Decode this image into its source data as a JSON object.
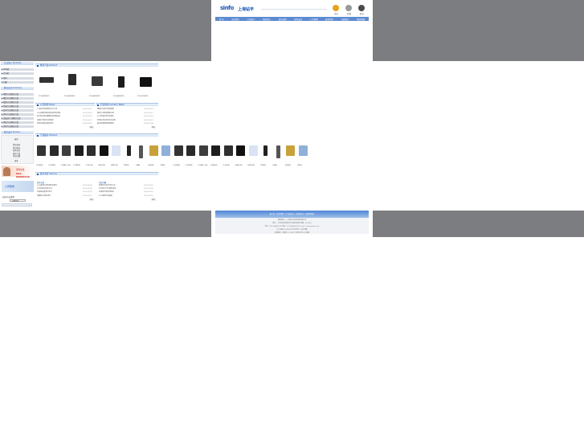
{
  "header": {
    "logo_text": "sinfo",
    "brand_name": "上海钻丰",
    "icons": [
      {
        "name": "home-icon",
        "label": "首页",
        "color": "#e6a21e"
      },
      {
        "name": "favorite-icon",
        "label": "收藏",
        "color": "#9a9a9a"
      },
      {
        "name": "contact-icon",
        "label": "联系",
        "color": "#4a4a4a"
      }
    ]
  },
  "nav": {
    "items": [
      "首 页",
      "关于我们",
      "产品中心",
      "新闻中心",
      "成功案例",
      "技术支持",
      "人才招聘",
      "联系我们",
      "在线留言",
      "网站地图"
    ]
  },
  "sidebar": {
    "products_title": "产品中心 Products",
    "product_categories": [
      "POS机",
      "打印机"
    ],
    "product_items": [
      "条码",
      "扫描",
      "其他"
    ],
    "industry_title": "解决方案 Solutions",
    "industries": [
      "零售行业解决方案",
      "餐饮行业解决方案",
      "服装行业解决方案",
      "物流行业解决方案",
      "医药行业解决方案",
      "超市行业解决方案",
      "连锁店行业解决方案",
      "酒店行业解决方案",
      "其他行业解决方案"
    ],
    "service_title": "服务支持 Service",
    "service_heading": "服务",
    "service_items": [
      "售前咨询",
      "售后服务",
      "技术支持",
      "驱动下载",
      "常见问题"
    ],
    "service_more": "更多",
    "sales_hotline": "021-68580128",
    "sales_label": "销售热线",
    "honor_label": "公司荣誉",
    "search_label": "站内产品搜索",
    "search_select_value": "全部分类"
  },
  "featured": {
    "title": "推荐产品 Product",
    "items": [
      "POS收银机系列",
      "POS收银机系列",
      "POS收银机系列",
      "POS收银机系列",
      "POS打印机系列"
    ]
  },
  "news": {
    "left_title": "公司新闻 News",
    "right_title": "行业新闻 Industry News",
    "left_items": [
      {
        "title": "上海钻丰收银系统正式上线",
        "date": "2011-03-21"
      },
      {
        "title": "POS收银机如何选择适合的机型",
        "date": "2011-03-18"
      },
      {
        "title": "钻丰科技参加零售展会圆满成功",
        "date": "2011-03-15"
      },
      {
        "title": "热敏打印机的日常维护",
        "date": "2011-03-12"
      },
      {
        "title": "条码扫描枪的使用技巧",
        "date": "2011-03-10"
      }
    ],
    "right_items": [
      {
        "title": "零售业信息化发展趋势",
        "date": "2011-03-20"
      },
      {
        "title": "餐饮行业收银系统应用",
        "date": "2011-03-17"
      },
      {
        "title": "POS终端市场分析报告",
        "date": "2011-03-14"
      },
      {
        "title": "条码技术在物流中的应用",
        "date": "2011-03-11"
      },
      {
        "title": "超市收银管理系统解析",
        "date": "2011-03-08"
      }
    ],
    "more": "更多"
  },
  "gallery": {
    "title": "产品展示 Product",
    "items": [
      "POS收银机",
      "POS收银机",
      "POS触摸一体机",
      "POS触摸机",
      "POS打印机",
      "热敏打印机",
      "标签打印机",
      "手持终端",
      "扫描枪",
      "条码标签",
      "客显屏",
      "POS收银机",
      "POS收银机",
      "POS触摸一体机",
      "POS触摸机",
      "POS打印机",
      "热敏打印机",
      "标签打印机",
      "手持终端",
      "扫描枪",
      "条码标签",
      "客显屏"
    ]
  },
  "support": {
    "title": "技术支持 Service",
    "left_heading": "技术文档",
    "right_heading": "常见问题",
    "left_items": [
      {
        "title": "POS收银机安装使用说明书",
        "date": "2011-03-20"
      },
      {
        "title": "打印机驱动安装方法",
        "date": "2011-03-18"
      },
      {
        "title": "扫描枪设置条码大全",
        "date": "2011-03-15"
      },
      {
        "title": "钱箱接口连接说明",
        "date": "2011-03-12"
      }
    ],
    "right_items": [
      {
        "title": "收银机无法开机怎么办",
        "date": "2011-03-19"
      },
      {
        "title": "打印机打印不清晰 解决",
        "date": "2011-03-16"
      },
      {
        "title": "扫描枪不读码的原因",
        "date": "2011-03-13"
      },
      {
        "title": "POS系统常见故障",
        "date": "2011-03-10"
      }
    ],
    "more": "更多"
  },
  "footer": {
    "links": "首 页 | 关于我们 | 产品中心 | 新闻中心 | 联系我们",
    "lines": [
      "版权所有 © 上海钻丰信息科技有限公司",
      "地址：上海市浦东新区张江高科技园区 邮编：201203",
      "电话：021-68580128 传真：021-68580129 E-mail：sales@sinfo.com",
      "沪ICP备05012345号 技术支持：钻丰网络",
      "友情链接：收银机 | POS机 | 条码打印机 | 扫描枪"
    ]
  },
  "colors": {
    "page_gray": "#7b7d80",
    "nav_blue": "#5d8ad0",
    "brand_blue": "#1a56b8",
    "hotline_red": "#d0201c"
  }
}
